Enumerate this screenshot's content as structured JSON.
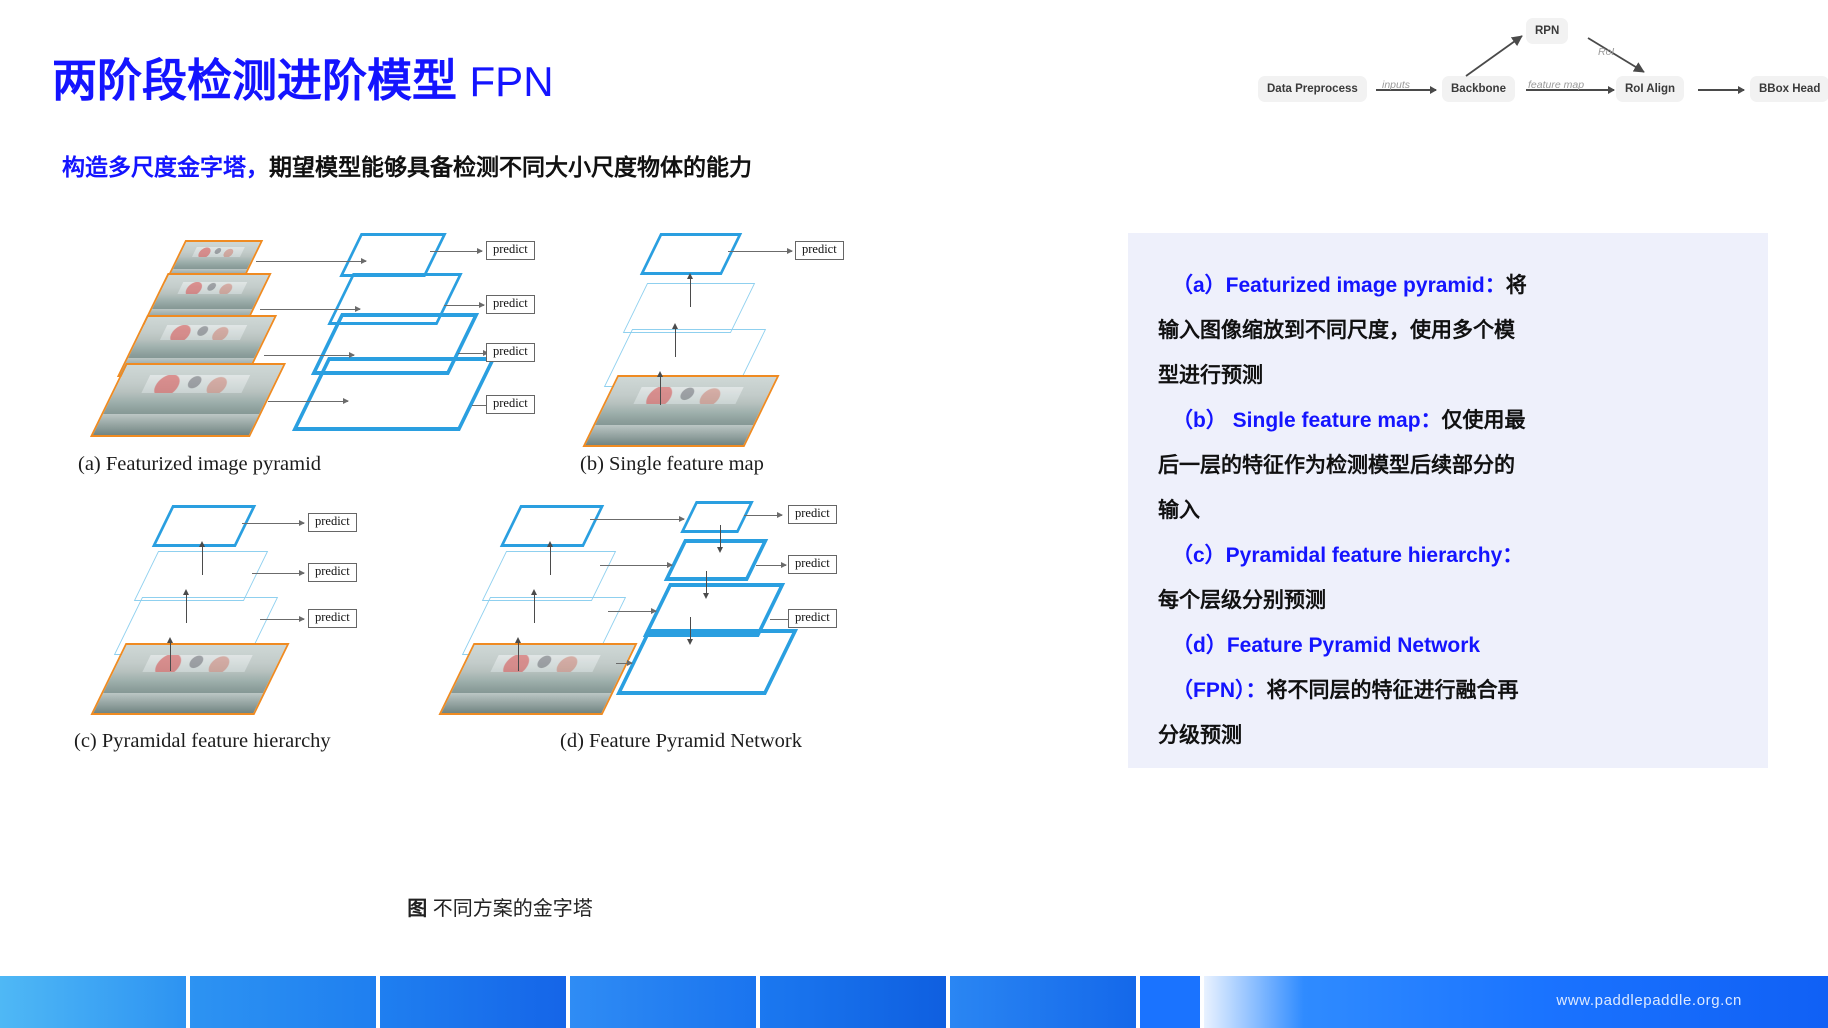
{
  "header": {
    "title_cn": "两阶段检测进阶模型",
    "title_en": "FPN",
    "subtitle_hl": "构造多尺度金字塔，",
    "subtitle_rest": "期望模型能够具备检测不同大小尺度物体的能力",
    "title_color": "#1414ff"
  },
  "pipeline": {
    "nodes": [
      {
        "id": "data-preprocess",
        "label": "Data Preprocess"
      },
      {
        "id": "backbone",
        "label": "Backbone"
      },
      {
        "id": "rpn",
        "label": "RPN"
      },
      {
        "id": "roi-align",
        "label": "RoI Align"
      },
      {
        "id": "bbox-head",
        "label": "BBox Head"
      }
    ],
    "edge_labels": [
      {
        "id": "inputs",
        "label": "inputs"
      },
      {
        "id": "feature-map",
        "label": "feature map"
      },
      {
        "id": "roi",
        "label": "RoI"
      }
    ]
  },
  "figure": {
    "caption_label": "图",
    "caption_text": "不同方案的金字塔",
    "panels": [
      {
        "key": "a",
        "caption": "(a) Featurized image pyramid",
        "predicts": [
          "predict",
          "predict",
          "predict",
          "predict"
        ]
      },
      {
        "key": "b",
        "caption": "(b) Single feature map",
        "predicts": [
          "predict"
        ]
      },
      {
        "key": "c",
        "caption": "(c) Pyramidal feature hierarchy",
        "predicts": [
          "predict",
          "predict",
          "predict"
        ]
      },
      {
        "key": "d",
        "caption": "(d) Feature Pyramid Network",
        "predicts": [
          "predict",
          "predict",
          "predict"
        ]
      }
    ],
    "colors": {
      "feature_map_border": "#2a9fe0",
      "image_border": "#ef8b22"
    }
  },
  "explanation": {
    "background": "#eef0fb",
    "lines": [
      {
        "blue": "（a）Featurized image pyramid：",
        "black": "将",
        "indent": true
      },
      {
        "blue": "",
        "black": "输入图像缩放到不同尺度，使用多个模",
        "indent": false
      },
      {
        "blue": "",
        "black": "型进行预测",
        "indent": false
      },
      {
        "blue": "（b） Single feature map：",
        "black": "仅使用最",
        "indent": true
      },
      {
        "blue": "",
        "black": "后一层的特征作为检测模型后续部分的",
        "indent": false
      },
      {
        "blue": "",
        "black": "输入",
        "indent": false
      },
      {
        "blue": "（c）Pyramidal feature hierarchy：",
        "black": "",
        "indent": true
      },
      {
        "blue": "",
        "black": "每个层级分别预测",
        "indent": false
      },
      {
        "blue": "（d）Feature Pyramid Network",
        "black": "",
        "indent": true
      },
      {
        "blue": "（FPN）：",
        "black": "将不同层的特征进行融合再",
        "indent": true
      },
      {
        "blue": "",
        "black": "分级预测",
        "indent": false
      }
    ]
  },
  "footer": {
    "url": "www.paddlepaddle.org.cn",
    "accent": "#1a73ff"
  }
}
